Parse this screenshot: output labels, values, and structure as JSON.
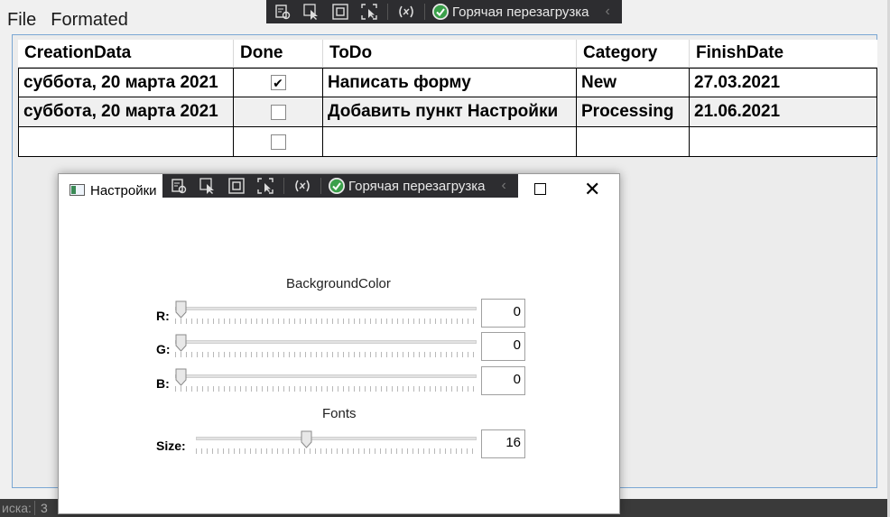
{
  "menu": {
    "file": "File",
    "formated": "Formated"
  },
  "toolbar": {
    "hot_reload": "Горячая перезагрузка"
  },
  "grid": {
    "columns": [
      "CreationData",
      "Done",
      "ToDo",
      "Category",
      "FinishDate"
    ],
    "rows": [
      {
        "creation": "суббота, 20 марта 2021",
        "done": true,
        "todo": "Написать форму",
        "category": "New",
        "finish": "27.03.2021"
      },
      {
        "creation": "суббота, 20 марта 2021",
        "done": false,
        "todo": "Добавить пункт Настройки",
        "category": "Processing",
        "finish": "21.06.2021"
      },
      {
        "creation": "",
        "done": false,
        "todo": "",
        "category": "",
        "finish": ""
      }
    ]
  },
  "status": {
    "label": "иска:",
    "value": "3"
  },
  "dialog": {
    "title": "Настройки",
    "toolbar_hot_reload": "Горячая перезагрузка",
    "background_section": "BackgroundColor",
    "r_label": "R:",
    "r_value": "0",
    "g_label": "G:",
    "g_value": "0",
    "b_label": "B:",
    "b_value": "0",
    "fonts_section": "Fonts",
    "size_label": "Size:",
    "size_value": "16",
    "size_level_fraction": 0.39
  },
  "colors": {
    "toolbar_bg": "#2d2d30",
    "hot_reload_green": "#3aa04a",
    "frame_border": "#7aa7d4"
  }
}
